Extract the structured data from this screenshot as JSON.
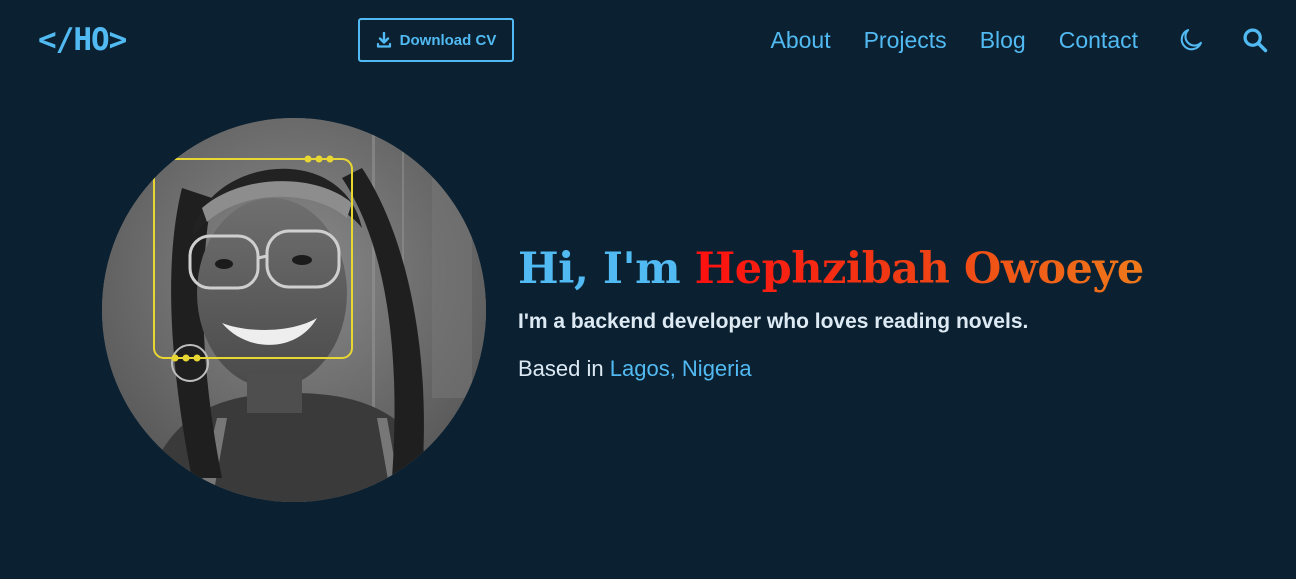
{
  "header": {
    "logo": "</HO>",
    "download_cv_label": "Download CV",
    "nav": [
      {
        "label": "About"
      },
      {
        "label": "Projects"
      },
      {
        "label": "Blog"
      },
      {
        "label": "Contact"
      }
    ],
    "theme_toggle_icon": "moon-icon",
    "search_icon": "search-icon"
  },
  "hero": {
    "greeting_prefix": "Hi, I'm",
    "name": "Hephzibah Owoeye",
    "tagline": "I'm a backend developer who loves reading novels.",
    "location_prefix": "Based in",
    "location": "Lagos, Nigeria",
    "avatar_icon": "profile-photo"
  },
  "colors": {
    "background": "#0b2131",
    "accent": "#52baf2",
    "name_gradient_start": "#ff1010",
    "name_gradient_end": "#ef7a1a",
    "text": "#dde9f3",
    "frame_yellow": "#e8d633"
  }
}
